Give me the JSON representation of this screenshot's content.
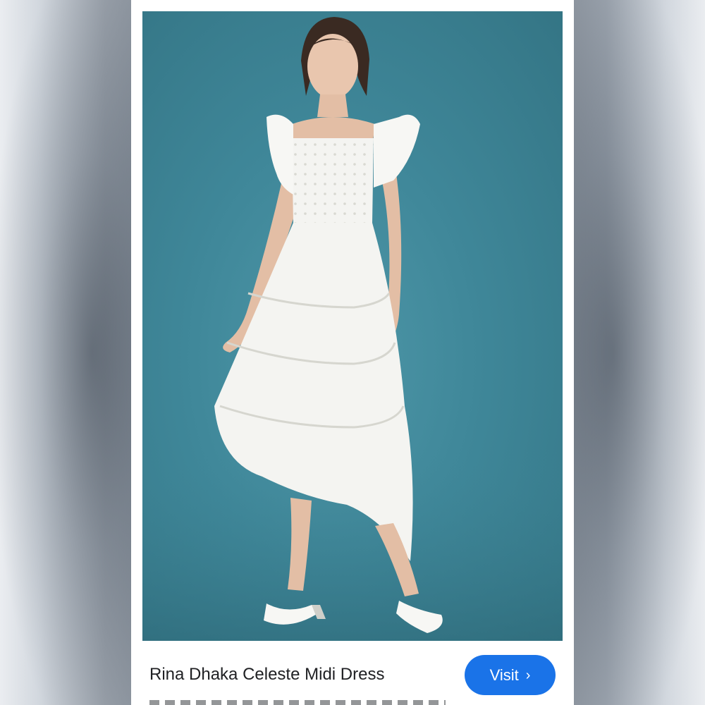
{
  "product": {
    "title": "Rina Dhaka Celeste Midi Dress"
  },
  "actions": {
    "visit_label": "Visit",
    "visit_icon": "chevron-right-icon",
    "chevron_glyph": "›"
  },
  "colors": {
    "accent": "#1a73e8",
    "photo_background": "#3f8799",
    "dress": "#f4f4f1"
  }
}
